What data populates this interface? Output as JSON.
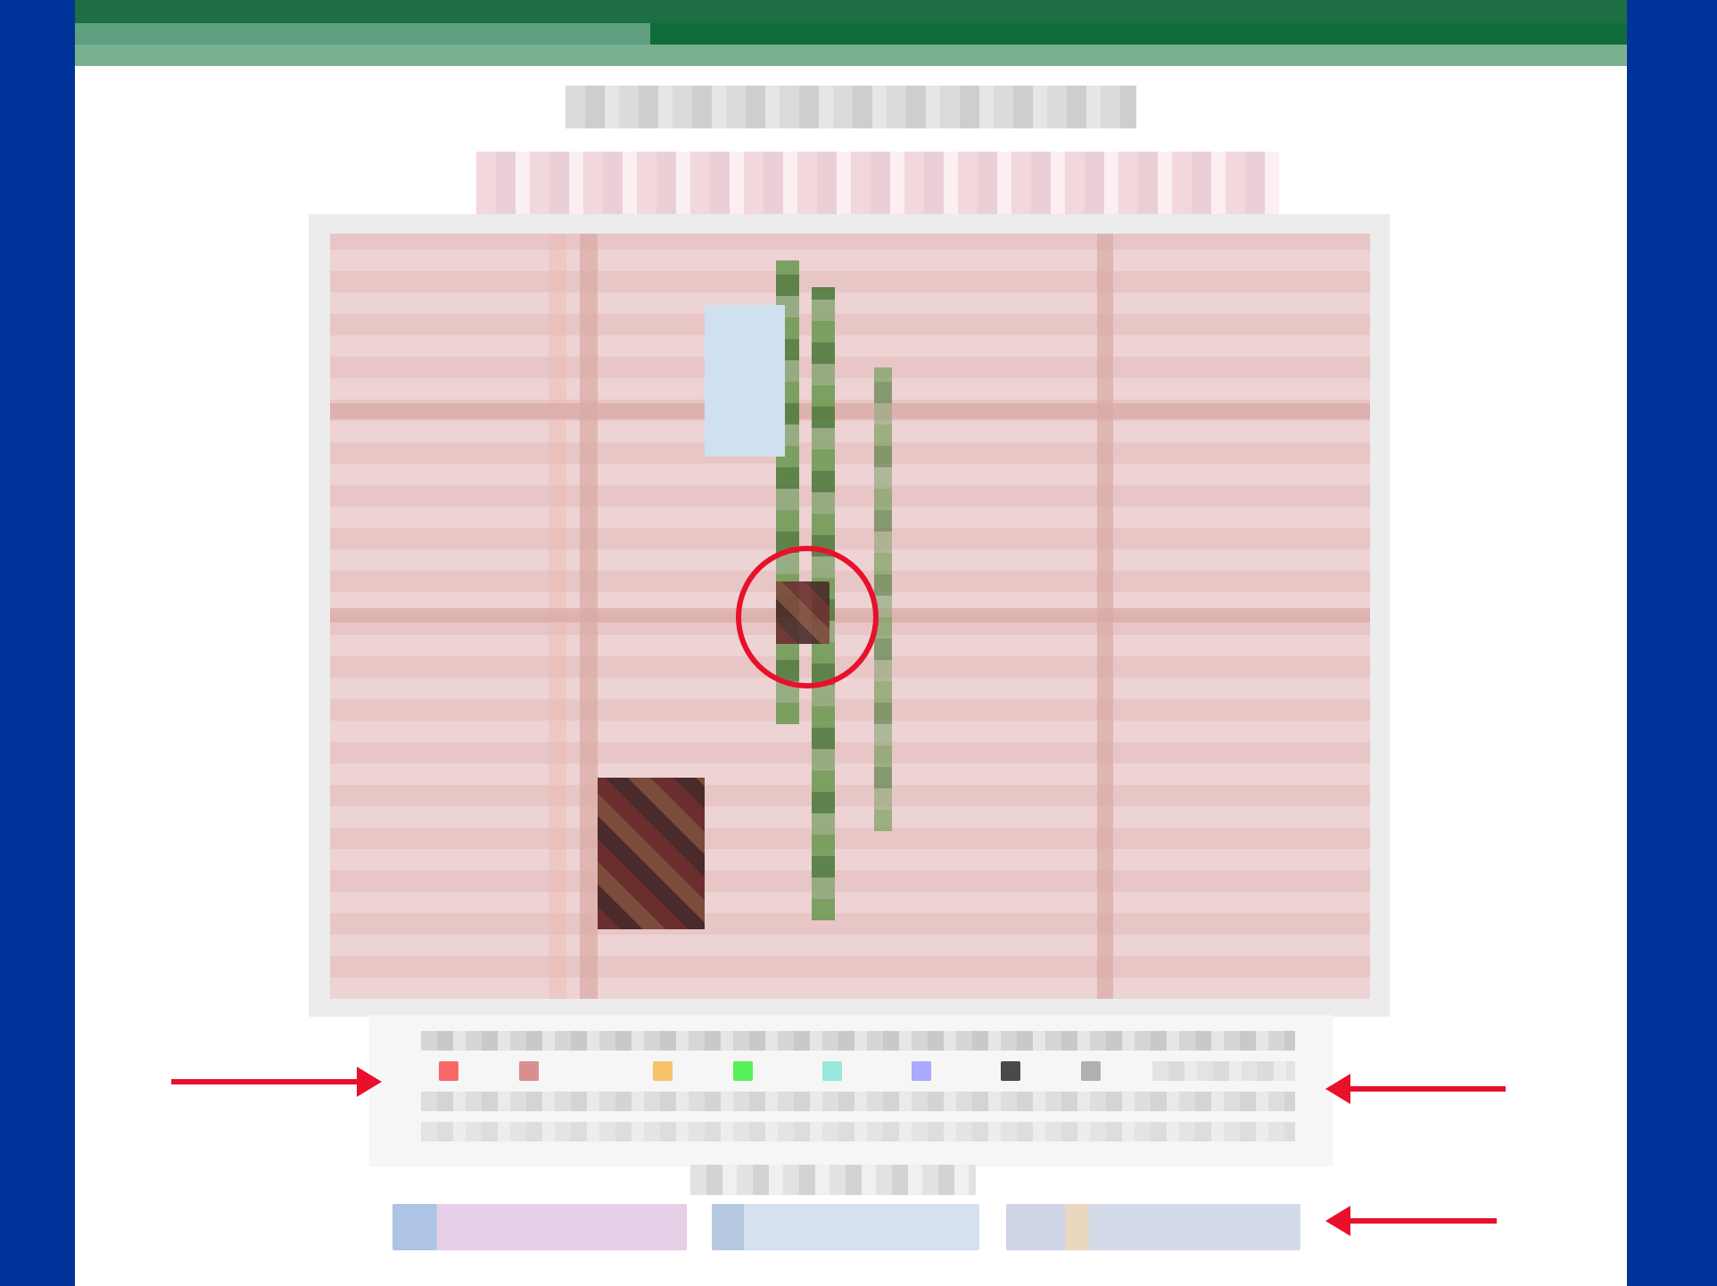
{
  "colors": {
    "side_background": "#003399",
    "header_dark": "#1e6e45",
    "header_light": "#79b190",
    "accent_red": "#e8102b"
  },
  "header": {
    "bar": ""
  },
  "main": {
    "title": "",
    "subtitle": ""
  },
  "map": {
    "marker": "circle-marker",
    "legend": {
      "items": []
    }
  },
  "footer": {
    "note": "",
    "links": []
  }
}
